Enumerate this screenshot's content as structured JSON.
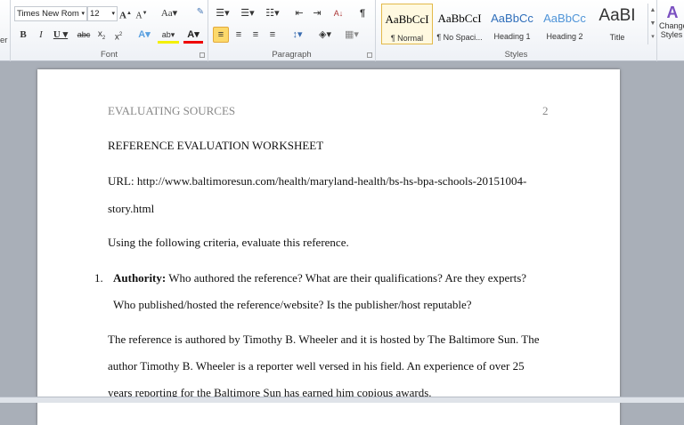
{
  "ribbon": {
    "font": {
      "name": "Times New Rom",
      "size": "12",
      "group_label": "Font"
    },
    "paragraph": {
      "group_label": "Paragraph"
    },
    "styles": {
      "group_label": "Styles",
      "items": [
        {
          "sample": "AaBbCcI",
          "label": "¶ Normal",
          "color": "#000000"
        },
        {
          "sample": "AaBbCcI",
          "label": "¶ No Spaci...",
          "color": "#000000"
        },
        {
          "sample": "AaBbCc",
          "label": "Heading 1",
          "color": "#2f6eba"
        },
        {
          "sample": "AaBbCc",
          "label": "Heading 2",
          "color": "#4f94d8"
        },
        {
          "sample": "AaBI",
          "label": "Title",
          "color": "#333333"
        }
      ]
    },
    "change_styles": "Change Styles",
    "clipboard_partial": "er"
  },
  "document": {
    "header_title": "EVALUATING SOURCES",
    "page_number": "2",
    "lines": [
      "REFERENCE EVALUATION WORKSHEET",
      "URL: http://www.baltimoresun.com/health/maryland-health/bs-hs-bpa-schools-20151004-",
      "story.html",
      "Using the following criteria, evaluate this reference."
    ],
    "item1": {
      "number": "1.",
      "label": "Authority:",
      "text": " Who authored the reference? What are their qualifications? Are they experts?",
      "text2": "Who published/hosted the reference/website? Is the publisher/host reputable?"
    },
    "answer": [
      "The reference is authored by Timothy B. Wheeler and it is hosted by The Baltimore Sun. The",
      "author Timothy B. Wheeler is a reporter well versed in his field. An experience of over 25",
      "years reporting for the Baltimore Sun has earned him copious awards."
    ]
  }
}
